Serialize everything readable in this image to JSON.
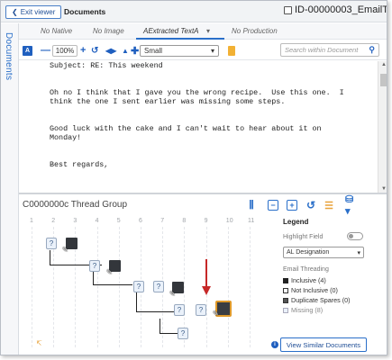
{
  "topbar": {
    "exit_label": "Exit viewer",
    "title": "Documents",
    "doc_id": "ID-00000003_EmailT"
  },
  "rail": {
    "label": "Documents"
  },
  "tabs": [
    {
      "label": "No Native"
    },
    {
      "label": "No Image"
    },
    {
      "label": "AExtracted TextA"
    },
    {
      "label": "No Production"
    }
  ],
  "toolbar": {
    "zoom": "100%",
    "size_select": "Small",
    "search_placeholder": "Search within Document"
  },
  "document": {
    "lines": [
      "Subject: RE: This weekend",
      "",
      "",
      "Oh no I think that I gave you the wrong recipe.  Use this one.  I",
      "think the one I sent earlier was missing some steps.",
      "",
      "",
      "Good luck with the cake and I can't wait to hear about it on",
      "Monday!",
      "",
      "",
      "Best regards,"
    ]
  },
  "thread_group": {
    "title": "C0000000c Thread Group",
    "columns": [
      "1",
      "2",
      "3",
      "4",
      "5",
      "6",
      "7",
      "8",
      "9",
      "10",
      "11"
    ]
  },
  "legend": {
    "title": "Legend",
    "highlight_field_label": "Highlight Field",
    "highlight_select": "AL Designation",
    "email_threading_label": "Email Threading",
    "items": [
      {
        "label": "Inclusive (4)",
        "color": "#222222"
      },
      {
        "label": "Not Inclusive (0)",
        "color": "#ffffff"
      },
      {
        "label": "Duplicate Spares (0)",
        "color": "#555555"
      },
      {
        "label": "Missing (8)",
        "color": "#eaf1fa"
      }
    ]
  },
  "view_similar_label": "View Similar Documents",
  "colors": {
    "accent": "#2a6fc9",
    "selected_border": "#e09a2a",
    "arrow": "#c62828"
  }
}
